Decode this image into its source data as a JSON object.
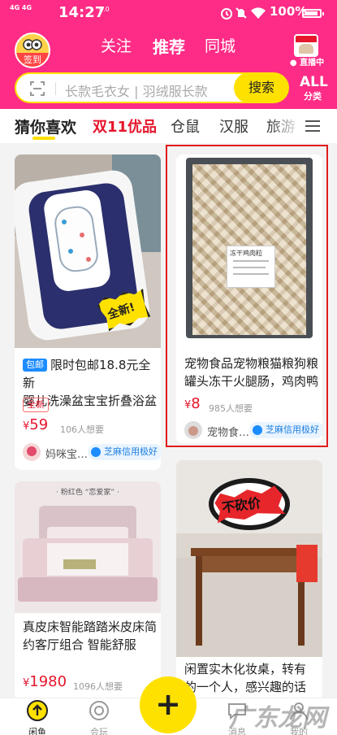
{
  "status_bar": {
    "signal": "4G 4G",
    "time": "14:27",
    "extra": "0.0",
    "battery_percent": "100%"
  },
  "header": {
    "signin_label": "签到",
    "nav": [
      "关注",
      "推荐",
      "同城"
    ],
    "live_label": "● 直播中",
    "search_placeholder": "长款毛衣女 | 羽绒服长款",
    "search_button": "搜索",
    "all_categories_big": "ALL",
    "all_categories_small": "分类"
  },
  "tabs": [
    "猜你喜欢",
    "双11优品",
    "仓鼠",
    "汉服",
    "旅游"
  ],
  "cards": [
    {
      "tag": "包邮",
      "title_line1": "限时包邮18.8元全新",
      "title_line2": "婴儿洗澡盆宝宝折叠浴盆",
      "new_tag": "全新",
      "yen": "¥",
      "price": "59",
      "want": "106人想要",
      "seller": "妈咪宝…",
      "credit": "芝麻信用极好",
      "sticker": "全新!"
    },
    {
      "title_line1": "宠物食品宠物粮猫粮狗粮",
      "title_line2": "罐头冻干火腿肠，鸡肉鸭",
      "yen": "¥",
      "price": "8",
      "want": "985人想要",
      "seller": "宠物食…",
      "credit": "芝麻信用极好",
      "label_text": "冻干鸡肉粒"
    },
    {
      "title_line1": "真皮床智能踏踏米皮床简",
      "title_line2": "约客厅组合 智能舒服",
      "yen": "¥",
      "price": "1980",
      "want": "1096人想要",
      "caption": "· 粉红色 “恋爱家” ·"
    },
    {
      "title_line1": "闲置实木化妆桌，转有",
      "title_line2": "的一个人，感兴趣的话",
      "sign_text": "不砍价"
    }
  ],
  "bottom_nav": [
    {
      "label": "闲鱼"
    },
    {
      "label": "会玩"
    },
    {
      "label": "消息"
    },
    {
      "label": "我的"
    }
  ],
  "fab": "+",
  "watermark": "广东龙网",
  "colors": {
    "header": "#fe2c86",
    "accent": "#ffe100",
    "price": "#e6162d",
    "credit": "#1c7fe0"
  }
}
